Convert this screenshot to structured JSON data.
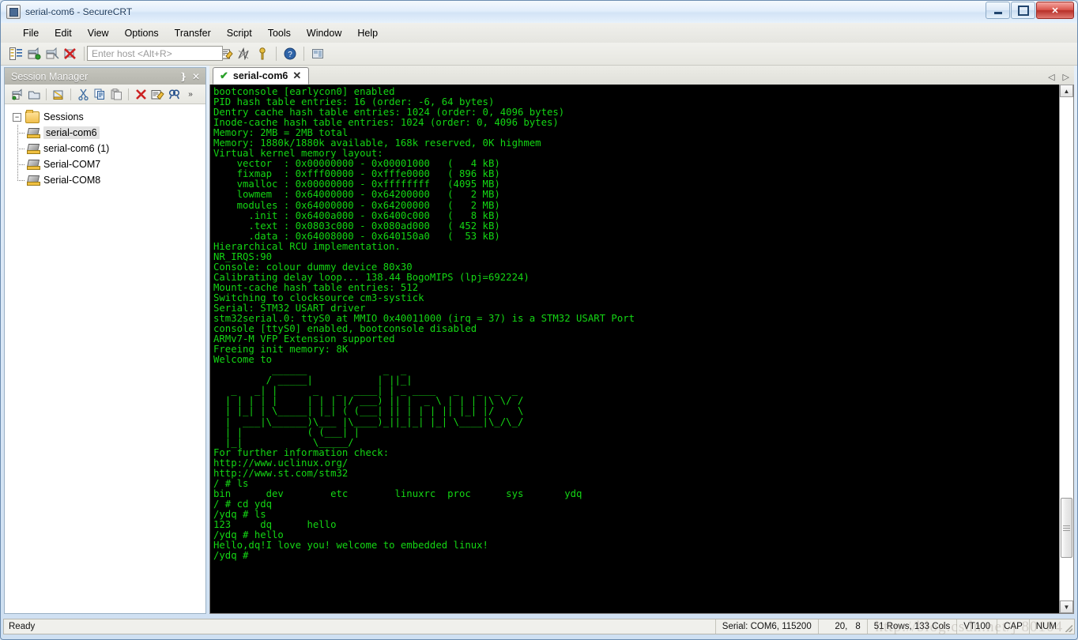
{
  "window": {
    "title": "serial-com6 - SecureCRT",
    "icon": "app-icon",
    "buttons": {
      "minimize": "–",
      "maximize": "□",
      "close": "✕"
    }
  },
  "menubar": {
    "items": [
      "File",
      "Edit",
      "View",
      "Options",
      "Transfer",
      "Script",
      "Tools",
      "Window",
      "Help"
    ]
  },
  "toolbar": {
    "host_placeholder": "Enter host <Alt+R>",
    "icons": [
      "session-manager-icon",
      "connect-icon",
      "connect-sftp-icon",
      "disconnect-icon"
    ],
    "icons2": [
      "copy-icon",
      "paste-icon",
      "find-icon"
    ],
    "icons3": [
      "print-icon",
      "log-session-icon",
      "print-screen-icon"
    ],
    "icons4": [
      "session-options-icon",
      "global-options-icon",
      "key-icon"
    ],
    "icons5": [
      "help-icon"
    ],
    "icons6": [
      "arrange-icon"
    ]
  },
  "session_manager": {
    "title": "Session Manager",
    "pin": "❵",
    "close": "✕",
    "toolbar_icons": [
      "new-session-icon",
      "new-folder-icon",
      "connect-icon",
      "cut-icon",
      "copy-icon",
      "paste-icon",
      "delete-icon",
      "properties-icon",
      "find-icon",
      "overflow-icon"
    ],
    "overflow": "»",
    "tree": {
      "root_label": "Sessions",
      "root_expander": "−",
      "items": [
        {
          "label": "serial-com6",
          "selected": true
        },
        {
          "label": "serial-com6 (1)",
          "selected": false
        },
        {
          "label": "Serial-COM7",
          "selected": false
        },
        {
          "label": "Serial-COM8",
          "selected": false
        }
      ]
    }
  },
  "tabs": {
    "items": [
      {
        "label": "serial-com6",
        "connected_mark": "✔",
        "close": "✕",
        "active": true
      }
    ],
    "scroll_left": "◁",
    "scroll_right": "▷"
  },
  "terminal": {
    "foreground": "#14d614",
    "background": "#000000",
    "lines": [
      "bootconsole [earlycon0] enabled",
      "PID hash table entries: 16 (order: -6, 64 bytes)",
      "Dentry cache hash table entries: 1024 (order: 0, 4096 bytes)",
      "Inode-cache hash table entries: 1024 (order: 0, 4096 bytes)",
      "Memory: 2MB = 2MB total",
      "Memory: 1880k/1880k available, 168k reserved, 0K highmem",
      "Virtual kernel memory layout:",
      "    vector  : 0x00000000 - 0x00001000   (   4 kB)",
      "    fixmap  : 0xfff00000 - 0xfffe0000   ( 896 kB)",
      "    vmalloc : 0x00000000 - 0xffffffff   (4095 MB)",
      "    lowmem  : 0x64000000 - 0x64200000   (   2 MB)",
      "    modules : 0x64000000 - 0x64200000   (   2 MB)",
      "      .init : 0x6400a000 - 0x6400c000   (   8 kB)",
      "      .text : 0x0803c000 - 0x080ad000   ( 452 kB)",
      "      .data : 0x64008000 - 0x640150a0   (  53 kB)",
      "Hierarchical RCU implementation.",
      "NR_IRQS:90",
      "Console: colour dummy device 80x30",
      "Calibrating delay loop... 138.44 BogoMIPS (lpj=692224)",
      "Mount-cache hash table entries: 512",
      "Switching to clocksource cm3-systick",
      "Serial: STM32 USART driver",
      "stm32serial.0: ttyS0 at MMIO 0x40011000 (irq = 37) is a STM32 USART Port",
      "console [ttyS0] enabled, bootconsole disabled",
      "ARMv7-M VFP Extension supported",
      "Freeing init memory: 8K",
      "Welcome to"
    ],
    "ascii_art": [
      "          ______             _  _",
      "         / _____|           | ||_|",
      "   _   _| |      _   _  ____| | _ ____   _   _  _  _",
      "  | | | | |     | | | |/ ___) || |  _ \\ | | | |\\ \\/ /",
      "  | |_| | \\_____| |_| ( (___| || | | | || |_| |/    \\",
      "  |  ___|\\______)\\___ |\\____)_||_|_| |_| \\____|\\_/\\_/",
      "  | |           ( (___| |",
      "  |_|            \\_____/"
    ],
    "lines_after": [
      "For further information check:",
      "http://www.uclinux.org/",
      "http://www.st.com/stm32",
      "/ # ls",
      "bin      dev        etc        linuxrc  proc      sys       ydq",
      "/ # cd ydq",
      "/ydq # ls",
      "123     dq      hello",
      "/ydq # hello",
      "Hello,dq!I love you! welcome to embedded linux!",
      "/ydq # "
    ],
    "scrollbar": {
      "up": "▲",
      "down": "▼"
    }
  },
  "statusbar": {
    "message": "Ready",
    "connection": "Serial: COM6, 115200",
    "row": "20,",
    "col": "8",
    "size": "51 Rows, 133 Cols",
    "emulation": "VT100",
    "caps": "CAP",
    "num": "NUM"
  },
  "watermark": "http://blog.csdn.net/j      80104"
}
